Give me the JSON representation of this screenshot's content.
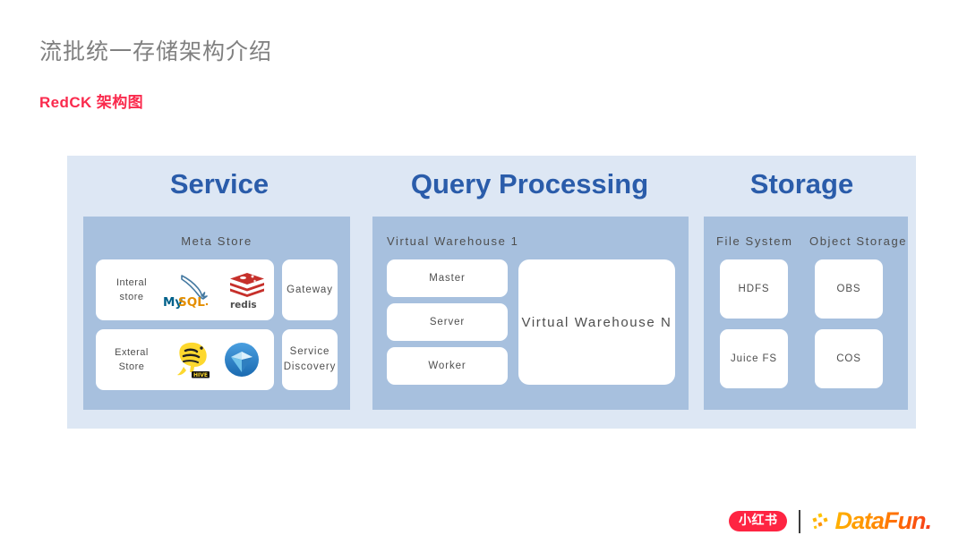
{
  "slide": {
    "title": "流批统一存储架构介绍",
    "subtitle": "RedCK 架构图"
  },
  "colors": {
    "heading_blue": "#2a5caa",
    "panel_blue": "#a7c0de",
    "frame_blue": "#dde7f4",
    "accent_red": "#fa2a4d",
    "xhs_red": "#fe2442",
    "datafun_orange": "#ff9000"
  },
  "diagram": {
    "columns": [
      {
        "id": "service",
        "heading": "Service",
        "panel_label": "Meta Store",
        "cards": [
          {
            "id": "internal-store",
            "label": "Interal\nstore",
            "logos": [
              "mysql-logo",
              "redis-logo"
            ]
          },
          {
            "id": "external-store",
            "label": "Exteral\nStore",
            "logos": [
              "hive-logo",
              "iceberg-logo"
            ]
          },
          {
            "id": "gateway",
            "label": "Gateway",
            "logos": []
          },
          {
            "id": "service-discovery",
            "label": "Service\nDiscovery",
            "logos": []
          }
        ]
      },
      {
        "id": "query-processing",
        "heading": "Query Processing",
        "panel_label": "Virtual Warehouse 1",
        "cards": [
          {
            "id": "master",
            "label": "Master"
          },
          {
            "id": "server",
            "label": "Server"
          },
          {
            "id": "worker",
            "label": "Worker"
          },
          {
            "id": "virtual-warehouse-n",
            "label": "Virtual  Warehouse  N"
          }
        ]
      },
      {
        "id": "storage",
        "heading": "Storage",
        "panel_labels": [
          "File System",
          "Object Storage"
        ],
        "cards": [
          {
            "id": "hdfs",
            "label": "HDFS"
          },
          {
            "id": "obs",
            "label": "OBS"
          },
          {
            "id": "juice-fs",
            "label": "Juice FS"
          },
          {
            "id": "cos",
            "label": "COS"
          }
        ]
      }
    ]
  },
  "footer": {
    "xiaohongshu": "小红书",
    "datafun": "DataFun."
  }
}
